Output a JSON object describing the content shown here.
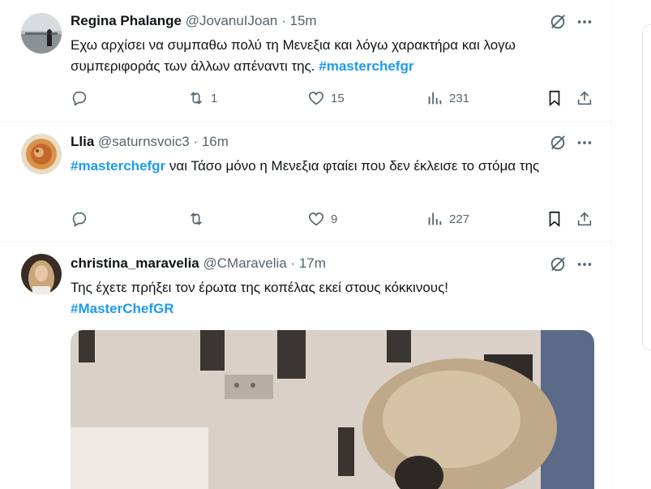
{
  "tweets": [
    {
      "name": "Regina Phalange",
      "handle": "@JovanuIJoan",
      "time": "· 15m",
      "text": "Εχω αρχίσει να συμπαθω πολύ τη Μενεξια και λόγω χαρακτήρα και λογω συμπεριφοράς των άλλων απέναντι της.",
      "hashtag": "#masterchefgr",
      "replies": "",
      "retweets": "1",
      "likes": "15",
      "views": "231"
    },
    {
      "name": "Llia",
      "handle": "@saturnsvoic3",
      "time": "· 16m",
      "hashtag": "#masterchefgr",
      "text": "ναι Τάσο μόνο η Μενεξια φταίει που δεν έκλεισε το στόμα της",
      "replies": "",
      "retweets": "",
      "likes": "9",
      "views": "227"
    },
    {
      "name": "christina_maravelia",
      "handle": "@CMaravelia",
      "time": "· 17m",
      "text": "Της έχετε πρήξει τον έρωτα της κοπέλας εκεί στους κόκκινους!",
      "hashtag": "#MasterChefGR"
    }
  ],
  "icons": {
    "grok": "grok-icon",
    "more": "more-icon",
    "reply": "reply-icon",
    "retweet": "retweet-icon",
    "like": "heart-icon",
    "views": "views-icon",
    "bookmark": "bookmark-icon",
    "share": "share-icon"
  },
  "colors": {
    "hashtag": "#1d9bf0",
    "secondary_text": "#536471",
    "divider": "#eff3f4"
  }
}
